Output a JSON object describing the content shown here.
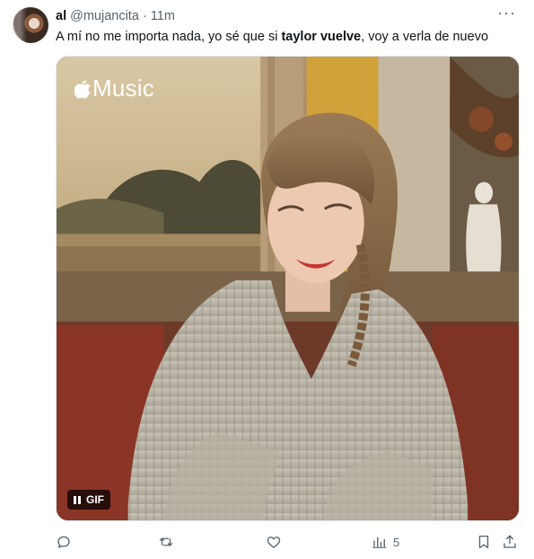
{
  "tweet": {
    "display_name": "al",
    "handle": "@mujancita",
    "separator": "·",
    "time": "11m",
    "more": "···",
    "text_before": "A mí no me importa nada, yo sé que si ",
    "text_bold": "taylor vuelve",
    "text_after": ", voy a verla de nuevo"
  },
  "media": {
    "watermark": "Music",
    "badge": "GIF"
  },
  "actions": {
    "views": "5"
  },
  "colors": {
    "text": "#0f1419",
    "secondary": "#536471"
  }
}
